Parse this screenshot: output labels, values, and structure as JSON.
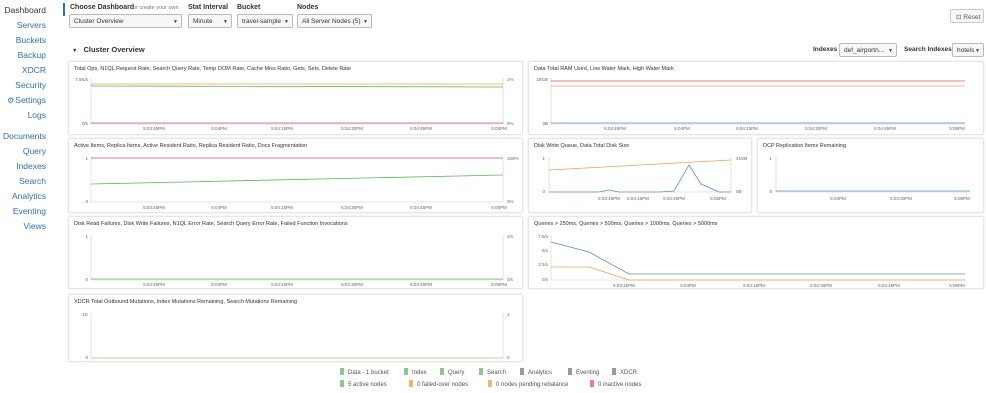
{
  "sidebar": {
    "items": [
      {
        "label": "Dashboard",
        "active": true
      },
      {
        "label": "Servers"
      },
      {
        "label": "Buckets"
      },
      {
        "label": "Backup"
      },
      {
        "label": "XDCR"
      },
      {
        "label": "Security"
      },
      {
        "label": "Settings",
        "icon": "gear-icon"
      },
      {
        "label": "Logs"
      },
      {
        "label": "Documents"
      },
      {
        "label": "Query"
      },
      {
        "label": "Indexes"
      },
      {
        "label": "Search"
      },
      {
        "label": "Analytics"
      },
      {
        "label": "Eventing"
      },
      {
        "label": "Views"
      }
    ]
  },
  "controls": {
    "choose_dashboard_label": "Choose Dashboard",
    "create_own": "or create your own",
    "dashboard_value": "Cluster Overview",
    "stat_interval_label": "Stat Interval",
    "stat_interval_value": "Minute",
    "bucket_label": "Bucket",
    "bucket_value": "travel-sample",
    "nodes_label": "Nodes",
    "nodes_value": "All Server Nodes (5)",
    "reset_label": "Reset"
  },
  "section": {
    "title": "Cluster Overview",
    "indexes_label": "Indexes",
    "indexes_value": "def_airportn...",
    "search_indexes_label": "Search Indexes",
    "search_indexes_value": "hotels"
  },
  "panels": [
    {
      "id": "p1",
      "title": "Total Ops, N1QL Request Rate, Search Query Rate, Temp OOM Rate, Cache Miss Ratio, Gets, Sets, Delete Rate",
      "y_left": [
        "7.5K/s",
        "0/s"
      ],
      "y_right": [
        "1%",
        "0%"
      ],
      "x_ticks": [
        "5:03:45PM",
        "5:04PM",
        "5:04:15PM",
        "5:04:30PM",
        "5:04:45PM",
        "5:05PM"
      ]
    },
    {
      "id": "p2",
      "title": "Data Total RAM Used, Low Water Mark, High Water Mark",
      "y_left": [
        "18GB",
        "0B"
      ],
      "y_right": [],
      "x_ticks": [
        "5:03:45PM",
        "5:04PM",
        "5:04:15PM",
        "5:04:30PM",
        "5:04:45PM",
        "5:05PM"
      ]
    },
    {
      "id": "p3",
      "title": "Active Items, Replica Items, Active Resident Ratio, Replica Resident Ratio, Docs Fragmentation",
      "y_left": [
        "1",
        "0"
      ],
      "y_right": [
        "100%",
        "0%"
      ],
      "x_ticks": [
        "5:03:45PM",
        "5:04PM",
        "5:04:15PM",
        "5:04:30PM",
        "5:04:45PM",
        "5:05PM"
      ]
    },
    {
      "id": "p4",
      "title": "Disk Write Queue, Data Total Disk Size",
      "y_left": [
        "1",
        "0"
      ],
      "y_right": [
        "410M",
        "0B"
      ],
      "x_ticks": [
        "5:03:45PM",
        "5:04:15PM",
        "5:04:45PM",
        "5:05PM"
      ]
    },
    {
      "id": "p5",
      "title": "DCP Replication Items Remaining",
      "y_left": [
        "1",
        "0"
      ],
      "y_right": [],
      "x_ticks": [
        "5:04PM",
        "5:04:30PM",
        "5:05PM"
      ]
    },
    {
      "id": "p6",
      "title": "Disk Read Failures, Disk Write Failures, N1QL Error Rate, Search Query Error Rate, Failed Function Invocations",
      "y_left": [
        "1",
        "0"
      ],
      "y_right": [
        "1/s",
        "0/s"
      ],
      "x_ticks": [
        "5:03:45PM",
        "5:04PM",
        "5:04:15PM",
        "5:04:30PM",
        "5:04:45PM",
        "5:05PM"
      ]
    },
    {
      "id": "p7",
      "title": "Queries > 250ms, Queries > 500ms, Queries > 1000ms, Queries > 5000ms",
      "y_left": [
        "7.5/s",
        "5/s",
        "2.5/s",
        "0/s"
      ],
      "y_right": [],
      "x_ticks": [
        "5:03:45PM",
        "5:04PM",
        "5:04:15PM",
        "5:04:30PM",
        "5:04:45PM",
        "5:05PM"
      ]
    },
    {
      "id": "p8",
      "title": "XDCR Total Outbound Mutations, Index Mutations Remaining, Search Mutations Remaining",
      "y_left": [
        "1K",
        "0"
      ],
      "y_right": [
        "1",
        "0"
      ],
      "x_ticks": []
    }
  ],
  "footer": {
    "services": [
      {
        "label": "Data - 1 bucket",
        "color": "#8fc88a"
      },
      {
        "label": "Index",
        "color": "#8fc88a"
      },
      {
        "label": "Query",
        "color": "#8fc88a"
      },
      {
        "label": "Search",
        "color": "#8fc88a"
      },
      {
        "label": "Analytics",
        "color": "#9a9a9a"
      },
      {
        "label": "Eventing",
        "color": "#9a9a9a"
      },
      {
        "label": "XDCR",
        "color": "#9a9a9a"
      }
    ],
    "nodes": [
      {
        "label": "5 active nodes",
        "color": "#8fc88a"
      },
      {
        "label": "0 failed-over nodes",
        "color": "#f2b36e"
      },
      {
        "label": "0 nodes pending rebalance",
        "color": "#f2b36e"
      },
      {
        "label": "0 inactive nodes",
        "color": "#f08080"
      }
    ]
  },
  "colors": {
    "link": "#2d6fb3",
    "green": "#5cb85c",
    "orange": "#f0a050",
    "red": "#e05050",
    "blue": "#5b8fd0"
  }
}
